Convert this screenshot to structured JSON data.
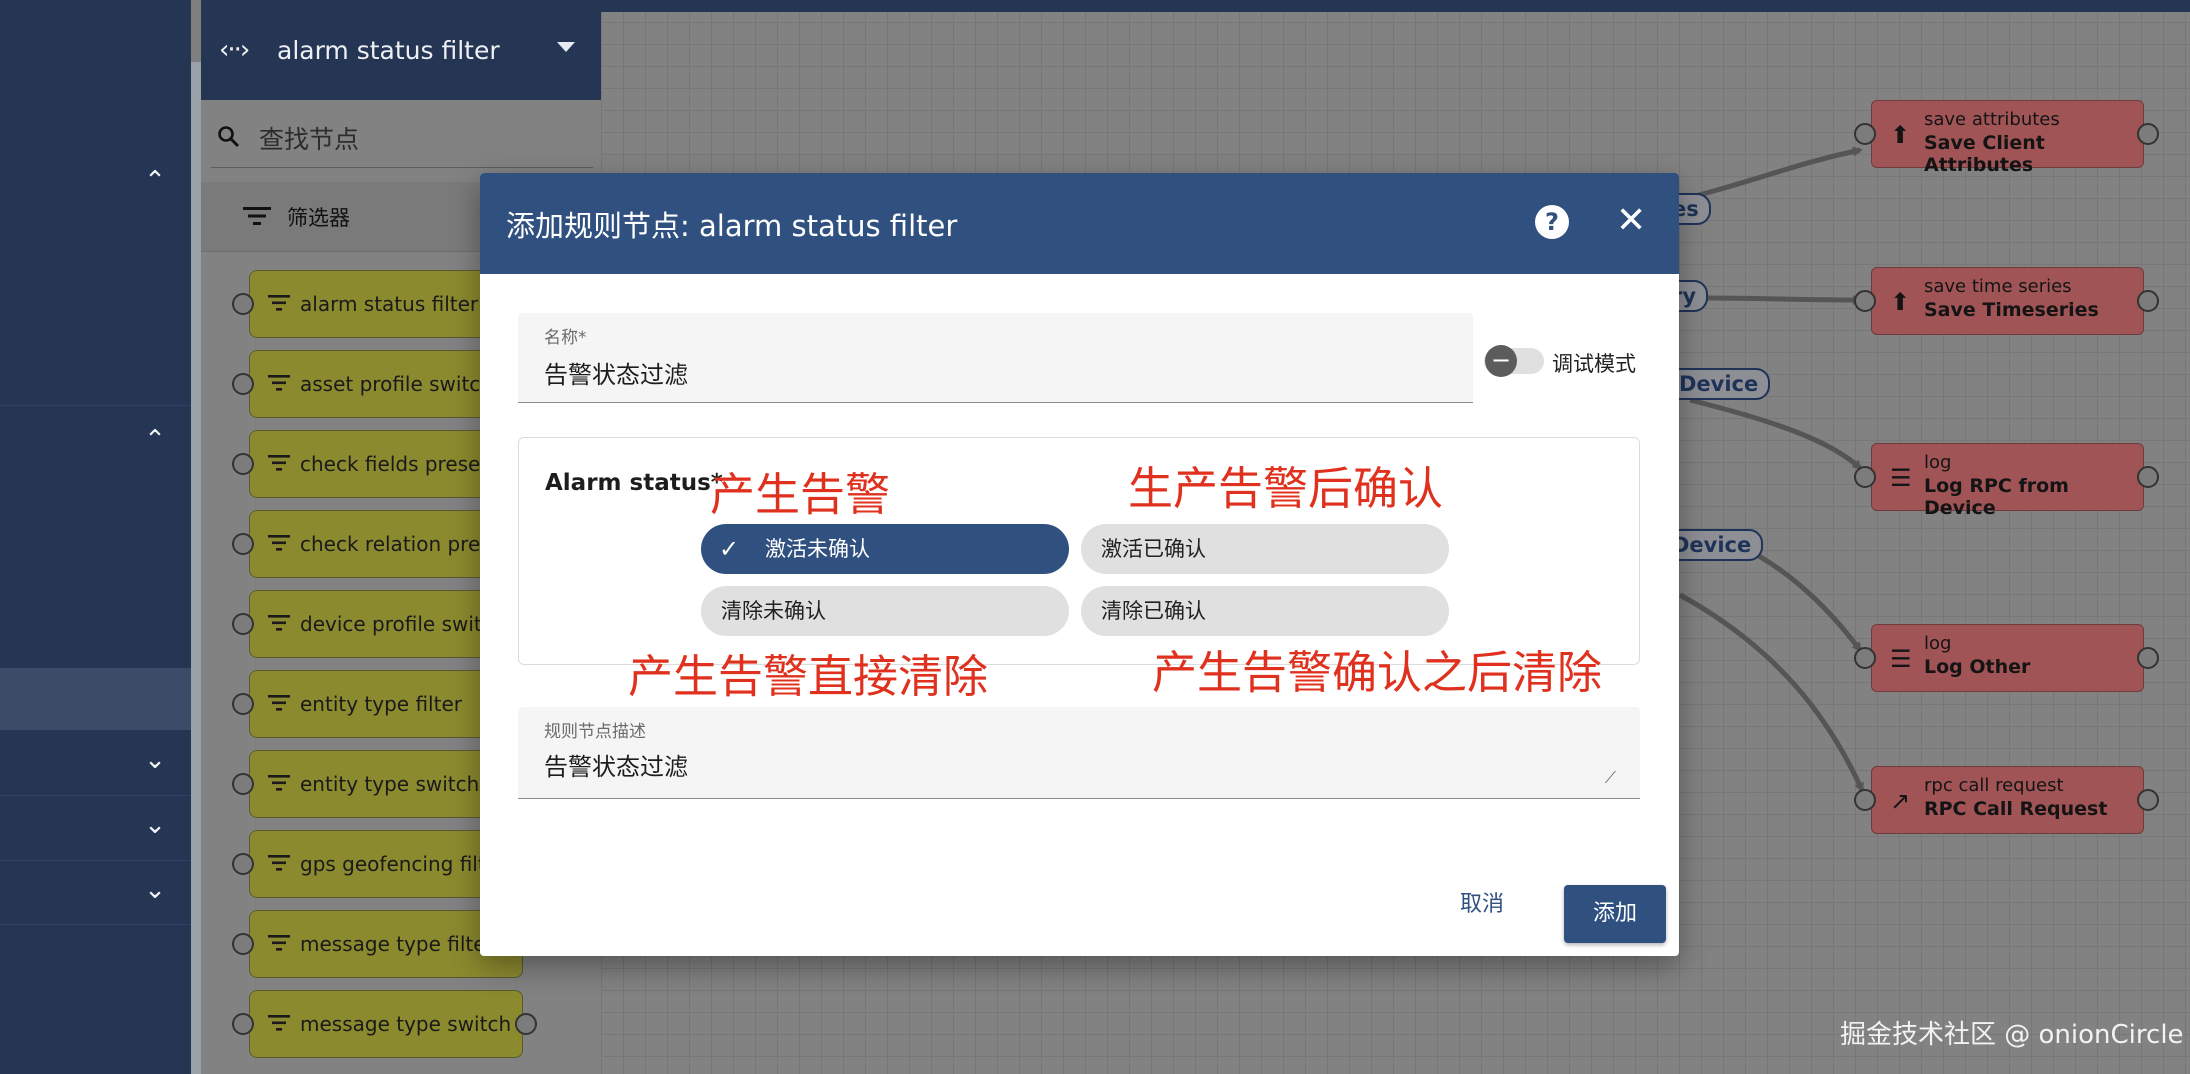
{
  "library": {
    "header_title": "alarm status filter",
    "search_placeholder": "查找节点",
    "section_title": "筛选器",
    "nodes": [
      "alarm status filter",
      "asset profile switch",
      "check fields presence",
      "check relation presence",
      "device profile switch",
      "entity type filter",
      "entity type switch",
      "gps geofencing filter",
      "message type filter",
      "message type switch"
    ]
  },
  "canvas": {
    "nodes": [
      {
        "type": "save attributes",
        "name": "Save Client Attributes",
        "icon": "upload-icon"
      },
      {
        "type": "save time series",
        "name": "Save Timeseries",
        "icon": "upload-icon"
      },
      {
        "type": "log",
        "name": "Log RPC from Device",
        "icon": "menu-icon"
      },
      {
        "type": "log",
        "name": "Log Other",
        "icon": "menu-icon"
      },
      {
        "type": "rpc call request",
        "name": "RPC Call Request",
        "icon": "arrow-up-right-icon"
      }
    ],
    "link_labels": [
      "es",
      "ry",
      "Device",
      "Device"
    ]
  },
  "dialog": {
    "title": "添加规则节点: alarm status filter",
    "name_field": {
      "label": "名称*",
      "value": "告警状态过滤"
    },
    "debug_label": "调试模式",
    "alarm_status": {
      "label": "Alarm status*",
      "options": [
        {
          "label": "激活未确认",
          "selected": true
        },
        {
          "label": "激活已确认",
          "selected": false
        },
        {
          "label": "清除未确认",
          "selected": false
        },
        {
          "label": "清除已确认",
          "selected": false
        }
      ]
    },
    "description_field": {
      "label": "规则节点描述",
      "value": "告警状态过滤"
    },
    "cancel_label": "取消",
    "add_label": "添加"
  },
  "annotations": [
    "产生告警",
    "生产告警后确认",
    "产生告警直接清除",
    "产生告警确认之后清除"
  ],
  "watermark": "掘金技术社区 @ onionCircle",
  "colors": {
    "primary": "#305180",
    "annotation": "#e0301e",
    "filter_node": "#8c8a2e",
    "action_node": "#a05456"
  }
}
